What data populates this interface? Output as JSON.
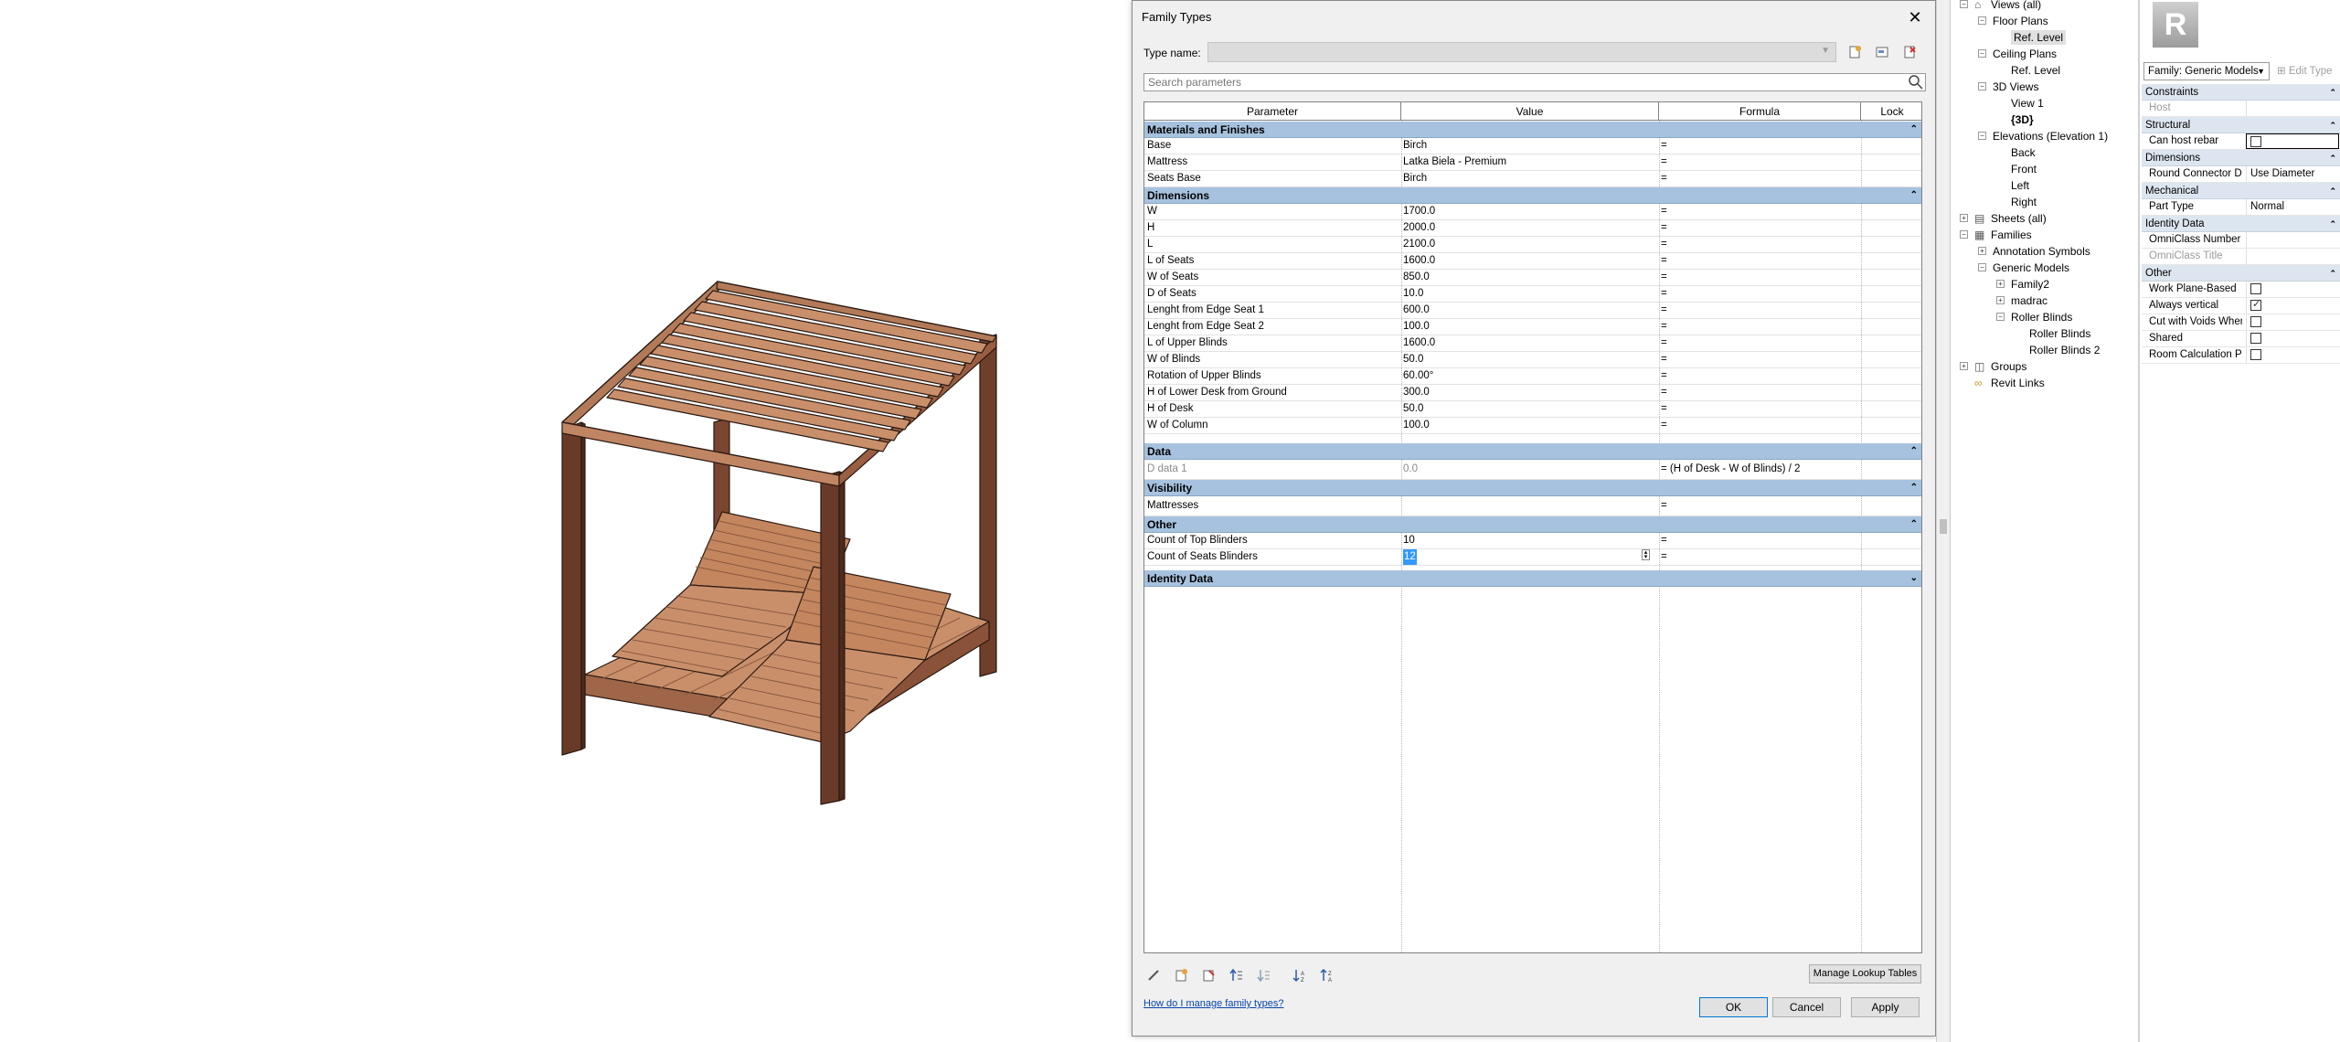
{
  "dialog": {
    "title": "Family Types",
    "type_name_label": "Type name:",
    "search_placeholder": "Search parameters",
    "columns": [
      "Parameter",
      "Value",
      "Formula",
      "Lock"
    ],
    "groups": {
      "materials": "Materials and Finishes",
      "dimensions": "Dimensions",
      "data": "Data",
      "visibility": "Visibility",
      "other": "Other",
      "identity": "Identity Data"
    },
    "materials_rows": [
      {
        "param": "Base",
        "value": "Birch",
        "formula": "="
      },
      {
        "param": "Mattress",
        "value": "Latka Biela - Premium",
        "formula": "="
      },
      {
        "param": "Seats Base",
        "value": "Birch",
        "formula": "="
      }
    ],
    "dimension_rows": [
      {
        "param": "W",
        "value": "1700.0",
        "formula": "="
      },
      {
        "param": "H",
        "value": "2000.0",
        "formula": "="
      },
      {
        "param": "L",
        "value": "2100.0",
        "formula": "="
      },
      {
        "param": "L of Seats",
        "value": "1600.0",
        "formula": "="
      },
      {
        "param": "W of Seats",
        "value": "850.0",
        "formula": "="
      },
      {
        "param": "D of Seats",
        "value": "10.0",
        "formula": "="
      },
      {
        "param": "Lenght from Edge Seat 1",
        "value": "600.0",
        "formula": "="
      },
      {
        "param": "Lenght from Edge Seat 2",
        "value": "100.0",
        "formula": "="
      },
      {
        "param": "L of Upper Blinds",
        "value": "1600.0",
        "formula": "="
      },
      {
        "param": "W of Blinds",
        "value": "50.0",
        "formula": "="
      },
      {
        "param": "Rotation of Upper Blinds",
        "value": "60.00°",
        "formula": "="
      },
      {
        "param": "H of Lower Desk from Ground",
        "value": "300.0",
        "formula": "="
      },
      {
        "param": "H of Desk",
        "value": "50.0",
        "formula": "="
      },
      {
        "param": "W of Column",
        "value": "100.0",
        "formula": "="
      }
    ],
    "data_rows": [
      {
        "param": "D data 1",
        "value": "0.0",
        "formula": "= (H of Desk - W of Blinds) / 2"
      }
    ],
    "visibility_rows": [
      {
        "param": "Mattresses",
        "formula": "="
      }
    ],
    "other_rows": [
      {
        "param": "Count of Top Blinders",
        "value": "10",
        "formula": "="
      },
      {
        "param": "Count of Seats Blinders",
        "value": "12",
        "formula": "="
      }
    ],
    "manage_lookup_label": "Manage Lookup Tables",
    "help_link": "How do I manage family types?",
    "ok_label": "OK",
    "cancel_label": "Cancel",
    "apply_label": "Apply"
  },
  "browser": {
    "items": [
      {
        "label": "Views (all)"
      },
      {
        "label": "Floor Plans"
      },
      {
        "label": "Ref. Level"
      },
      {
        "label": "Ceiling Plans"
      },
      {
        "label": "Ref. Level"
      },
      {
        "label": "3D Views"
      },
      {
        "label": "View 1"
      },
      {
        "label": "{3D}"
      },
      {
        "label": "Elevations (Elevation 1)"
      },
      {
        "label": "Back"
      },
      {
        "label": "Front"
      },
      {
        "label": "Left"
      },
      {
        "label": "Right"
      },
      {
        "label": "Sheets (all)"
      },
      {
        "label": "Families"
      },
      {
        "label": "Annotation Symbols"
      },
      {
        "label": "Generic Models"
      },
      {
        "label": "Family2"
      },
      {
        "label": "madrac"
      },
      {
        "label": "Roller Blinds"
      },
      {
        "label": "Roller Blinds"
      },
      {
        "label": "Roller Blinds 2"
      },
      {
        "label": "Groups"
      },
      {
        "label": "Revit Links"
      }
    ]
  },
  "properties": {
    "logo_letter": "R",
    "family_selector": "Family: Generic Models",
    "edit_type_label": "Edit Type",
    "groups": {
      "constraints": "Constraints",
      "structural": "Structural",
      "dimensions": "Dimensions",
      "mechanical": "Mechanical",
      "identity": "Identity Data",
      "other": "Other"
    },
    "rows": {
      "host": "Host",
      "can_host_rebar": "Can host rebar",
      "round_connector": "Round Connector Dimension",
      "round_connector_value": "Use Diameter",
      "part_type": "Part Type",
      "part_type_value": "Normal",
      "omniclass_num": "OmniClass Number",
      "omniclass_title": "OmniClass Title",
      "work_plane": "Work Plane-Based",
      "always_vertical": "Always vertical",
      "cut_with_voids": "Cut with Voids When Loaded",
      "shared": "Shared",
      "room_calc": "Room Calculation Point"
    }
  },
  "colors": {
    "wood_light": "#c98f6b",
    "wood_dark": "#6e3f2a",
    "group_header": "#a6c2de"
  }
}
